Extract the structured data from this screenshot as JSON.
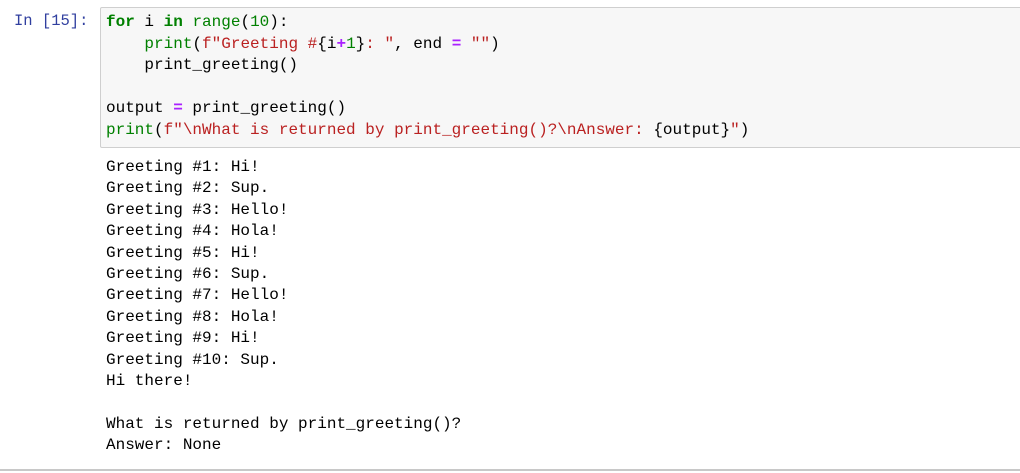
{
  "cell": {
    "prompt": "In [15]:",
    "code_lines": [
      [
        {
          "t": "kw",
          "v": "for"
        },
        {
          "t": "",
          "v": " i "
        },
        {
          "t": "kw",
          "v": "in"
        },
        {
          "t": "",
          "v": " "
        },
        {
          "t": "bi",
          "v": "range"
        },
        {
          "t": "",
          "v": "("
        },
        {
          "t": "num",
          "v": "10"
        },
        {
          "t": "",
          "v": "):"
        }
      ],
      [
        {
          "t": "",
          "v": "    "
        },
        {
          "t": "bi",
          "v": "print"
        },
        {
          "t": "",
          "v": "("
        },
        {
          "t": "str",
          "v": "f\"Greeting #"
        },
        {
          "t": "",
          "v": "{i"
        },
        {
          "t": "op",
          "v": "+"
        },
        {
          "t": "num",
          "v": "1"
        },
        {
          "t": "",
          "v": "}"
        },
        {
          "t": "str",
          "v": ": \""
        },
        {
          "t": "",
          "v": ", end "
        },
        {
          "t": "op",
          "v": "="
        },
        {
          "t": "",
          "v": " "
        },
        {
          "t": "str",
          "v": "\"\""
        },
        {
          "t": "",
          "v": ")"
        }
      ],
      [
        {
          "t": "",
          "v": "    print_greeting()"
        }
      ],
      [],
      [
        {
          "t": "",
          "v": "output "
        },
        {
          "t": "op",
          "v": "="
        },
        {
          "t": "",
          "v": " print_greeting()"
        }
      ],
      [
        {
          "t": "bi",
          "v": "print"
        },
        {
          "t": "",
          "v": "("
        },
        {
          "t": "str",
          "v": "f\"\\nWhat is returned by print_greeting()?\\nAnswer: "
        },
        {
          "t": "",
          "v": "{output}"
        },
        {
          "t": "str",
          "v": "\""
        },
        {
          "t": "",
          "v": ")"
        }
      ]
    ],
    "output_lines": [
      "Greeting #1: Hi!",
      "Greeting #2: Sup.",
      "Greeting #3: Hello!",
      "Greeting #4: Hola!",
      "Greeting #5: Hi!",
      "Greeting #6: Sup.",
      "Greeting #7: Hello!",
      "Greeting #8: Hola!",
      "Greeting #9: Hi!",
      "Greeting #10: Sup.",
      "Hi there!",
      "",
      "What is returned by print_greeting()?",
      "Answer: None"
    ]
  },
  "colors": {
    "prompt": "#303F9F",
    "keyword": "#008000",
    "string": "#BA2121",
    "operator": "#AA22FF",
    "input_background": "#f7f7f7"
  }
}
